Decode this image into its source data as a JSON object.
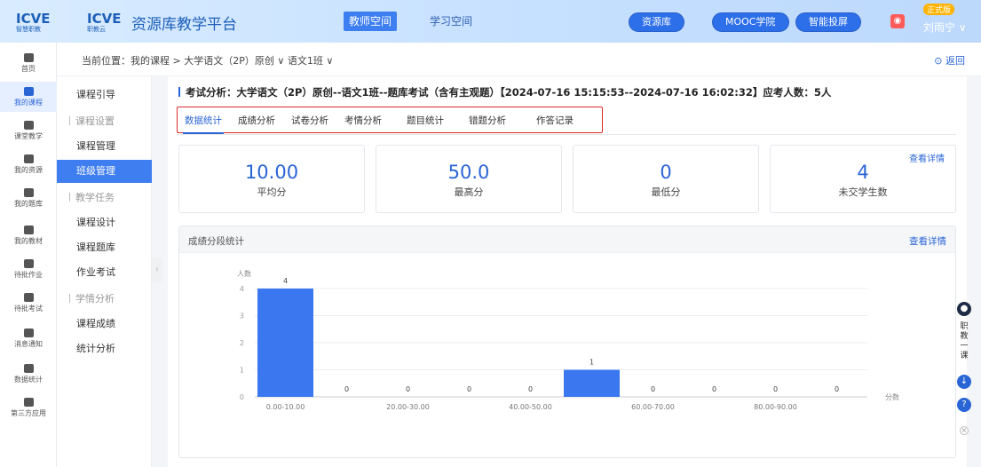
{
  "header": {
    "logo1": "ICVE",
    "logo1_sub": "智慧职教",
    "logo2": "ICVE",
    "logo2_sub": "职教云",
    "platform_title": "资源库教学平台",
    "teacher_space": "教师空间",
    "student_space": "学习空间",
    "pills": [
      "资源库",
      "MOOC学院",
      "智能投屏"
    ],
    "user_badge": "正式版",
    "user_name": "刘雨宁"
  },
  "left_nav": [
    {
      "label": "首页",
      "icon": "home-icon"
    },
    {
      "label": "我的课程",
      "icon": "course-icon",
      "active": true
    },
    {
      "label": "课堂教学",
      "icon": "play-icon"
    },
    {
      "label": "我的资源",
      "icon": "resource-icon"
    },
    {
      "label": "我的题库",
      "icon": "question-bank-icon"
    },
    {
      "label": "我的教材",
      "icon": "book-icon"
    },
    {
      "label": "待批作业",
      "icon": "homework-icon"
    },
    {
      "label": "待批考试",
      "icon": "exam-icon"
    },
    {
      "label": "消息通知",
      "icon": "message-icon"
    },
    {
      "label": "数据统计",
      "icon": "stats-icon"
    },
    {
      "label": "第三方应用",
      "icon": "apps-icon"
    }
  ],
  "breadcrumb": {
    "text": "当前位置：我的课程 > 大学语文（2P）原创 ∨ 语文1班 ∨",
    "back": "返回"
  },
  "sub_nav": [
    {
      "label": "课程引导",
      "type": "item"
    },
    {
      "label": "课程设置",
      "type": "group"
    },
    {
      "label": "课程管理",
      "type": "item"
    },
    {
      "label": "班级管理",
      "type": "item",
      "active": true
    },
    {
      "label": "教学任务",
      "type": "group"
    },
    {
      "label": "课程设计",
      "type": "item"
    },
    {
      "label": "课程题库",
      "type": "item"
    },
    {
      "label": "作业考试",
      "type": "item"
    },
    {
      "label": "学情分析",
      "type": "group"
    },
    {
      "label": "课程成绩",
      "type": "item"
    },
    {
      "label": "统计分析",
      "type": "item"
    }
  ],
  "exam_title": "考试分析：大学语文（2P）原创--语文1班--题库考试（含有主观题）【2024-07-16 15:15:53--2024-07-16 16:02:32】应考人数：5人",
  "tabs": [
    "数据统计",
    "成绩分析",
    "试卷分析",
    "考情分析",
    "题目统计",
    "错题分析",
    "作答记录"
  ],
  "stats": [
    {
      "value": "10.00",
      "label": "平均分"
    },
    {
      "value": "50.0",
      "label": "最高分"
    },
    {
      "value": "0",
      "label": "最低分"
    },
    {
      "value": "4",
      "label": "未交学生数",
      "more": "查看详情"
    }
  ],
  "panel": {
    "title": "成绩分段统计",
    "more": "查看详情"
  },
  "chart_data": {
    "type": "bar",
    "ylabel": "人数",
    "xlabel": "分数",
    "ylim": [
      0,
      4
    ],
    "yticks": [
      0,
      1,
      2,
      3,
      4
    ],
    "categories": [
      "0.00-10.00",
      "10.00-20.00",
      "20.00-30.00",
      "30.00-40.00",
      "40.00-50.00",
      "50.00-60.00",
      "60.00-70.00",
      "70.00-80.00",
      "80.00-90.00",
      "90.00-100.00"
    ],
    "category_labels_shown": [
      "0.00-10.00",
      "",
      "20.00-30.00",
      "",
      "40.00-50.00",
      "",
      "60.00-70.00",
      "",
      "80.00-90.00",
      ""
    ],
    "values": [
      4,
      0,
      0,
      0,
      0,
      1,
      0,
      0,
      0,
      0
    ],
    "bar_color": "#3b78f0",
    "grid": true
  },
  "right_tools": [
    "robot-icon",
    "职教一课",
    "download-icon",
    "help-icon",
    "close-icon"
  ]
}
